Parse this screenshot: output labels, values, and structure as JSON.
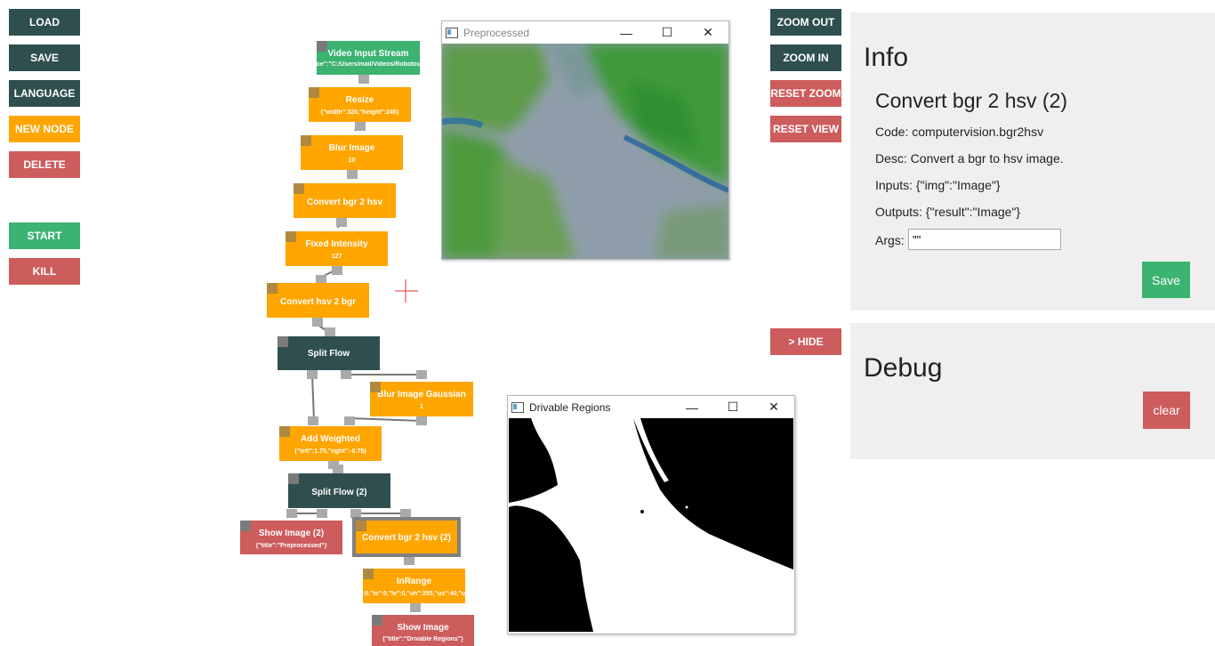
{
  "toolbar": {
    "load": "LOAD",
    "save": "SAVE",
    "language": "LANGUAGE",
    "new_node": "NEW NODE",
    "delete": "DELETE",
    "start": "START",
    "kill": "KILL"
  },
  "view_controls": {
    "zoom_out": "ZOOM OUT",
    "zoom_in": "ZOOM IN",
    "reset_zoom": "RESET ZOOM",
    "reset_view": "RESET VIEW",
    "hide": "> HIDE"
  },
  "nodes": {
    "video_input": {
      "title": "Video Input Stream",
      "sub": "ce\":\"C:/Users/mail/Videos/Robotour"
    },
    "resize": {
      "title": "Resize",
      "sub": "{\"width\":320,\"height\":240}"
    },
    "blur_image": {
      "title": "Blur Image",
      "sub": "10"
    },
    "convert_bgr_hsv": {
      "title": "Convert bgr 2 hsv",
      "sub": ""
    },
    "fixed_intensity": {
      "title": "Fixed Intensity",
      "sub": "127"
    },
    "convert_hsv_bgr": {
      "title": "Convert hsv 2 bgr",
      "sub": ""
    },
    "split_flow": {
      "title": "Split Flow",
      "sub": ""
    },
    "blur_gaussian": {
      "title": "Blur Image Gaussian",
      "sub": "1"
    },
    "add_weighted": {
      "title": "Add Weighted",
      "sub": "{\"left\":1.75,\"right\":-0.75}"
    },
    "split_flow_2": {
      "title": "Split Flow (2)",
      "sub": ""
    },
    "show_image_2": {
      "title": "Show Image (2)",
      "sub": "{\"title\":\"Preprocessed\"}"
    },
    "convert_bgr_hsv_2": {
      "title": "Convert bgr 2 hsv (2)",
      "sub": ""
    },
    "inrange": {
      "title": "InRange",
      "sub": ":0,\"ls\":0,\"lv\":0,\"uh\":255,\"us\":40,\"uv\":2"
    },
    "show_image": {
      "title": "Show Image",
      "sub": "{\"title\":\"Drivable Regions\"}"
    }
  },
  "windows": {
    "preprocessed": {
      "title": "Preprocessed"
    },
    "drivable": {
      "title": "Drivable Regions"
    },
    "minimize": "—",
    "maximize": "☐",
    "close": "✕"
  },
  "info": {
    "heading": "Info",
    "node_name": "Convert bgr 2 hsv (2)",
    "code": "Code: computervision.bgr2hsv",
    "desc": "Desc: Convert a bgr to hsv image.",
    "inputs": "Inputs: {\"img\":\"Image\"}",
    "outputs": "Outputs: {\"result\":\"Image\"}",
    "args_label": "Args:",
    "args_value": "\"\"",
    "save": "Save"
  },
  "debug": {
    "heading": "Debug",
    "clear": "clear"
  },
  "colors": {
    "dark": "#2f4f4f",
    "orange": "#ffa500",
    "red": "#cd5c5c",
    "green": "#3cb371"
  }
}
